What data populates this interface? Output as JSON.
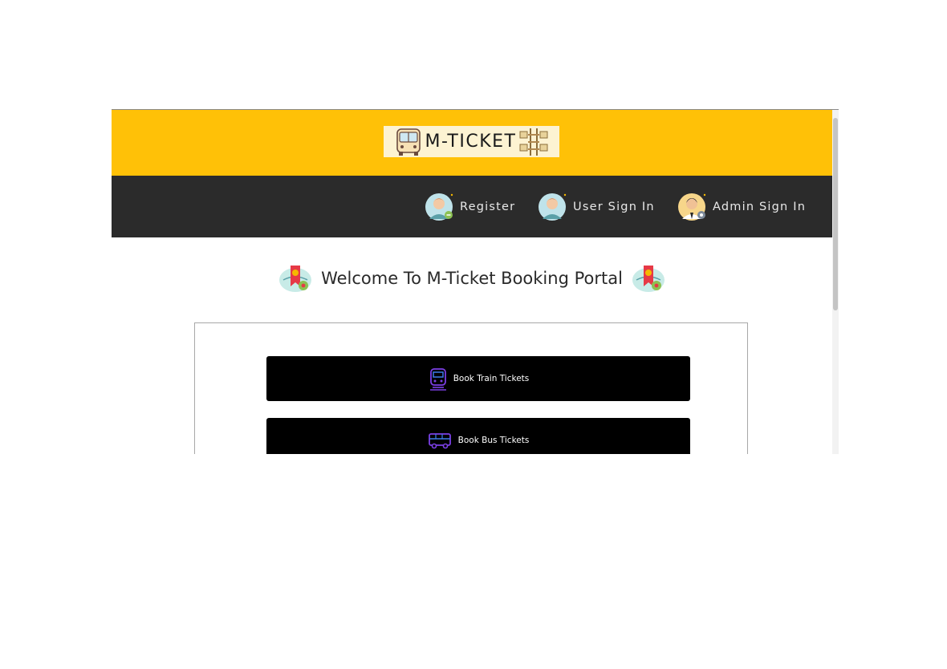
{
  "header": {
    "logo_text": "M-TICKET",
    "background_color": "#ffc107"
  },
  "nav": {
    "background_color": "#2b2b2b",
    "items": [
      {
        "label": "Register",
        "icon": "user-register-avatar-icon"
      },
      {
        "label": "User Sign In",
        "icon": "user-avatar-icon"
      },
      {
        "label": "Admin Sign In",
        "icon": "admin-avatar-icon"
      }
    ]
  },
  "welcome": {
    "title": "Welcome To M-Ticket Booking Portal",
    "icon": "ticket-badge-icon"
  },
  "actions": {
    "train_label": "Book Train Tickets",
    "bus_label": "Book Bus Tickets",
    "button_color": "#000000",
    "icon_color": "#7b3fe4"
  }
}
